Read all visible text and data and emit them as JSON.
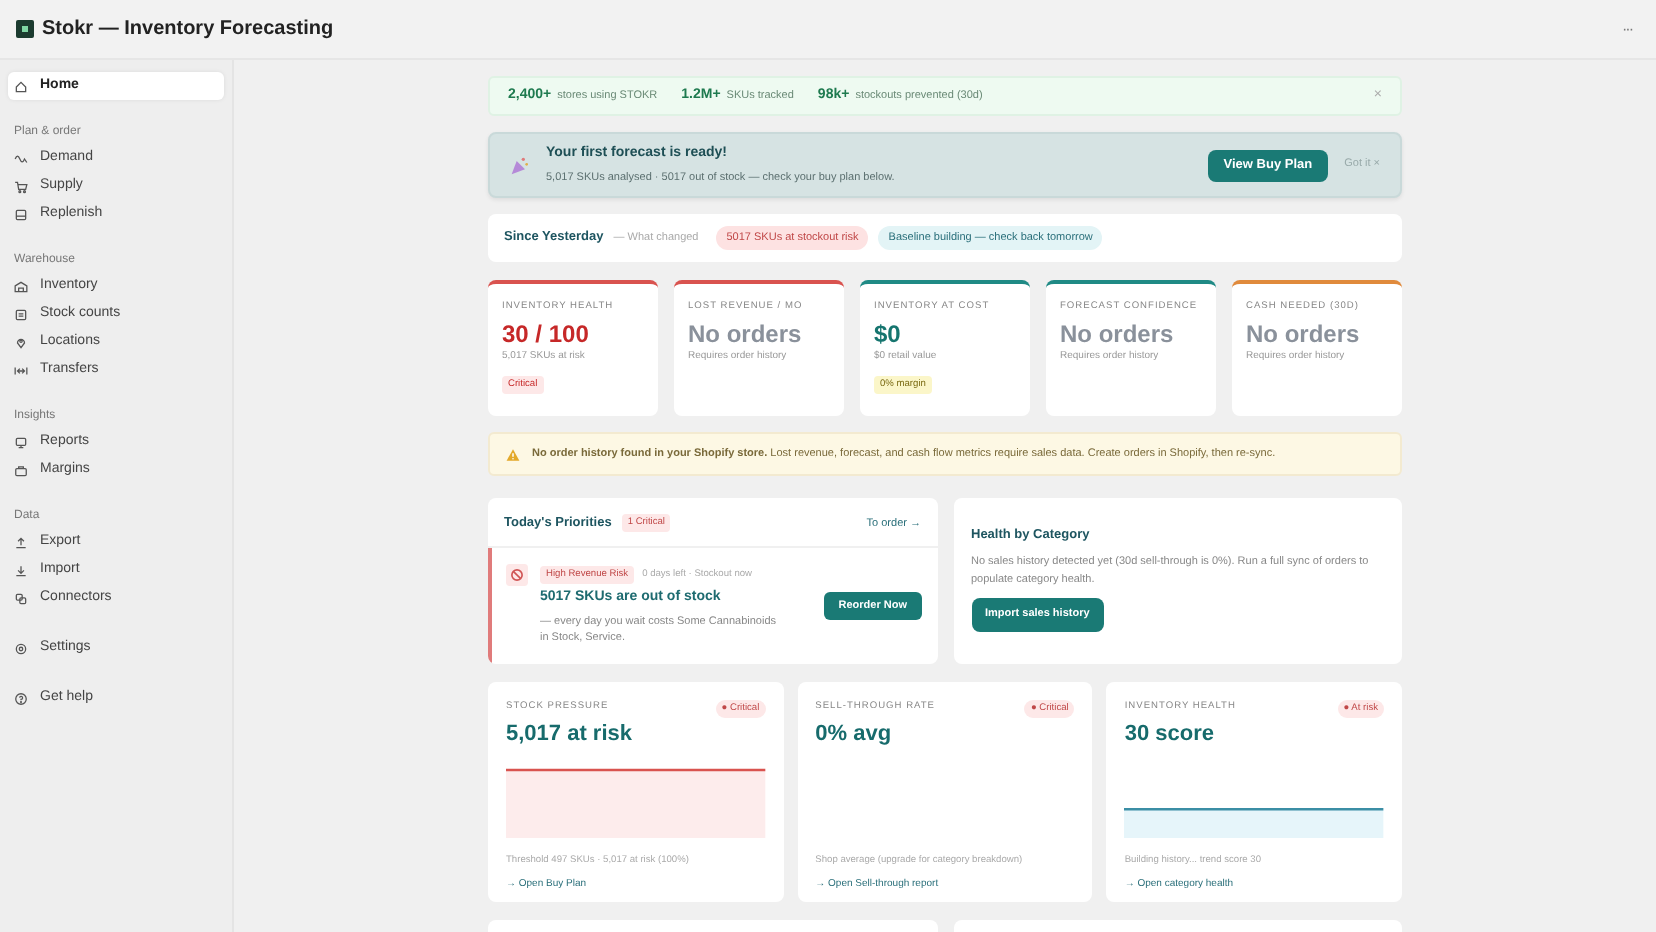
{
  "window": {
    "title": "Stokr — Inventory Forecasting",
    "menu": "···"
  },
  "sidebar": {
    "sections": [
      {
        "items": [
          {
            "label": "Home",
            "selected": true
          }
        ]
      },
      {
        "heading": "Plan & order",
        "items": [
          {
            "label": "Demand",
            "selected": false
          },
          {
            "label": "Supply",
            "selected": false
          },
          {
            "label": "Replenish",
            "selected": false
          }
        ]
      },
      {
        "heading": "Warehouse",
        "items": [
          {
            "label": "Inventory",
            "selected": false
          },
          {
            "label": "Stock counts",
            "selected": false
          },
          {
            "label": "Locations",
            "selected": false
          },
          {
            "label": "Transfers",
            "selected": false
          }
        ]
      },
      {
        "heading": "Insights",
        "items": [
          {
            "label": "Reports",
            "selected": false
          },
          {
            "label": "Margins",
            "selected": false
          }
        ]
      },
      {
        "heading": "Data",
        "items": [
          {
            "label": "Export",
            "selected": false
          },
          {
            "label": "Import",
            "selected": false
          },
          {
            "label": "Connectors",
            "selected": false
          }
        ]
      },
      {
        "items": [
          {
            "label": "Settings",
            "selected": false
          }
        ]
      },
      {
        "items": [
          {
            "label": "Get help",
            "selected": false
          }
        ]
      }
    ]
  },
  "stats_strip": {
    "stats": [
      {
        "value": "2,400+",
        "label": "stores using STOKR"
      },
      {
        "value": "1.2M+",
        "label": "SKUs tracked"
      },
      {
        "value": "98k+",
        "label": "stockouts prevented (30d)"
      }
    ],
    "close": "×"
  },
  "forecast_banner": {
    "title": "Your first forecast is ready!",
    "text": "5,017 SKUs analysed · 5017 out of stock — check your buy plan below.",
    "button": "View Buy Plan",
    "dismiss": "Got it ×"
  },
  "since_yesterday": {
    "title": "Since Yesterday",
    "subtitle": "— What changed",
    "chips": [
      {
        "label": "5017 SKUs at stockout risk",
        "color": "#fde2e2"
      },
      {
        "label": "Baseline building — check back tomorrow",
        "color": "#e3f4f6"
      }
    ]
  },
  "kpis": [
    {
      "label": "INVENTORY HEALTH",
      "value": "30 / 100",
      "note": "5,017 SKUs at risk",
      "badge": "Critical",
      "color": "#d9534f",
      "kind": "critical"
    },
    {
      "label": "LOST REVENUE / MO",
      "value": "No orders",
      "note": "Requires order history",
      "color": "#d9534f",
      "kind": "empty"
    },
    {
      "label": "INVENTORY AT COST",
      "value": "$0",
      "note": "$0 retail value",
      "badge": "0% margin",
      "color": "#1f8a85",
      "kind": "ok"
    },
    {
      "label": "FORECAST CONFIDENCE",
      "value": "No orders",
      "note": "Requires order history",
      "color": "#1f8a85",
      "kind": "empty"
    },
    {
      "label": "CASH NEEDED (30D)",
      "value": "No orders",
      "note": "Requires order history",
      "color": "#e08a3c",
      "kind": "empty"
    }
  ],
  "warning": {
    "text": "**No order history found in your Shopify store.** Lost revenue, forecast, and cash flow metrics require sales data. Create orders in Shopify, then re-sync."
  },
  "priorities": {
    "title": "Today's Priorities",
    "badge": "1 Critical",
    "link": "To order →",
    "item": {
      "tag": "High Revenue Risk",
      "meta": "0 days left · Stockout now",
      "title": "5017 SKUs are out of stock",
      "text": "— every day you wait costs Some Cannabinoids in Stock, Service.",
      "button": "Reorder Now"
    }
  },
  "health_by_category": {
    "title": "Health by Category",
    "text": "No sales history detected yet (30d sell-through is 0%). Run a full sync of orders to populate category health.",
    "button": "Import sales history"
  },
  "metric_cards": [
    {
      "label": "STOCK PRESSURE",
      "badge": "● Critical",
      "value": "5,017 at risk",
      "kind": "risk",
      "note": "Threshold 497 SKUs · 5,017 at risk (100%)",
      "link": "→ Open Buy Plan"
    },
    {
      "label": "SELL-THROUGH RATE",
      "badge": "● Critical",
      "value": "0% avg",
      "kind": "plain",
      "note": "Shop average (upgrade for category breakdown)",
      "link": "→ Open Sell-through report"
    },
    {
      "label": "INVENTORY HEALTH",
      "badge": "● At risk",
      "value": "30 score",
      "kind": "trend",
      "note": "Building history... trend score 30",
      "link": "→ Open category health"
    }
  ]
}
